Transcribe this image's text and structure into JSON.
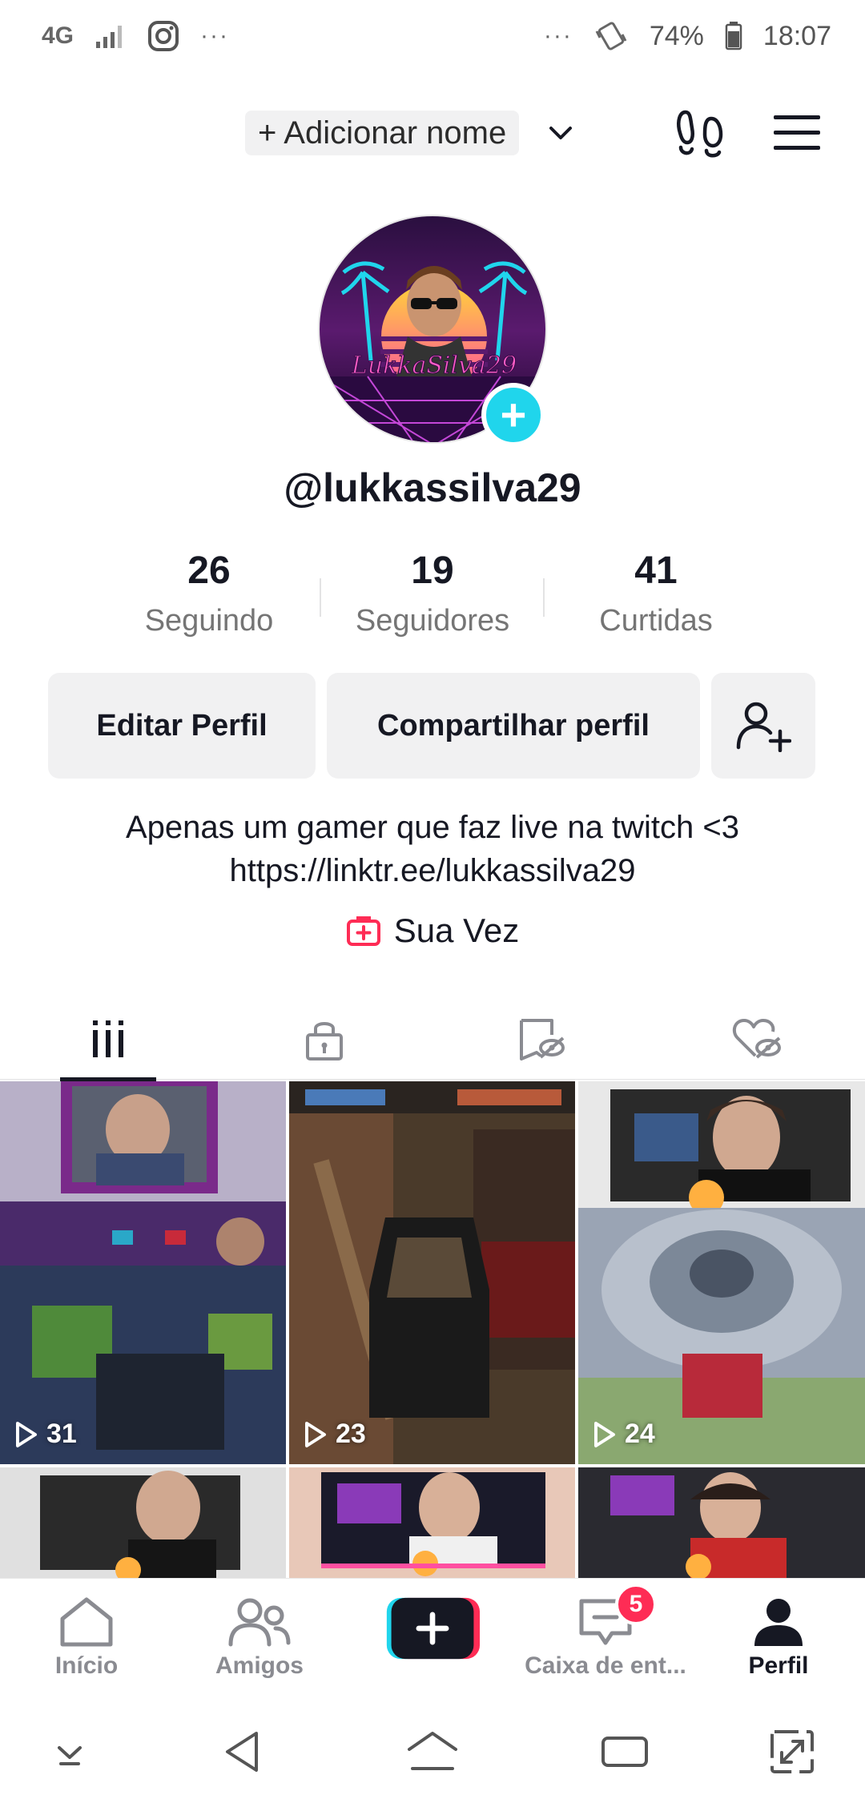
{
  "status_bar": {
    "network": "4G",
    "dots_left": "···",
    "dots_right": "···",
    "battery": "74%",
    "time": "18:07"
  },
  "header": {
    "add_name": "+ Adicionar nome"
  },
  "profile": {
    "username": "@lukkassilva29",
    "stats": [
      {
        "value": "26",
        "label": "Seguindo"
      },
      {
        "value": "19",
        "label": "Seguidores"
      },
      {
        "value": "41",
        "label": "Curtidas"
      }
    ],
    "edit_button": "Editar Perfil",
    "share_button": "Compartilhar perfil",
    "bio_line1": "Apenas um gamer que faz live na twitch <3",
    "bio_line2": "https://linktr.ee/lukkassilva29",
    "sua_vez": "Sua Vez"
  },
  "videos": [
    {
      "views": "31"
    },
    {
      "views": "23"
    },
    {
      "views": "24"
    }
  ],
  "bottom_nav": {
    "home": "Início",
    "friends": "Amigos",
    "inbox": "Caixa de ent...",
    "inbox_badge": "5",
    "profile": "Perfil"
  },
  "colors": {
    "accent_cyan": "#20d5ec",
    "accent_red": "#fe2c55",
    "text": "#161823",
    "muted": "#757575"
  }
}
